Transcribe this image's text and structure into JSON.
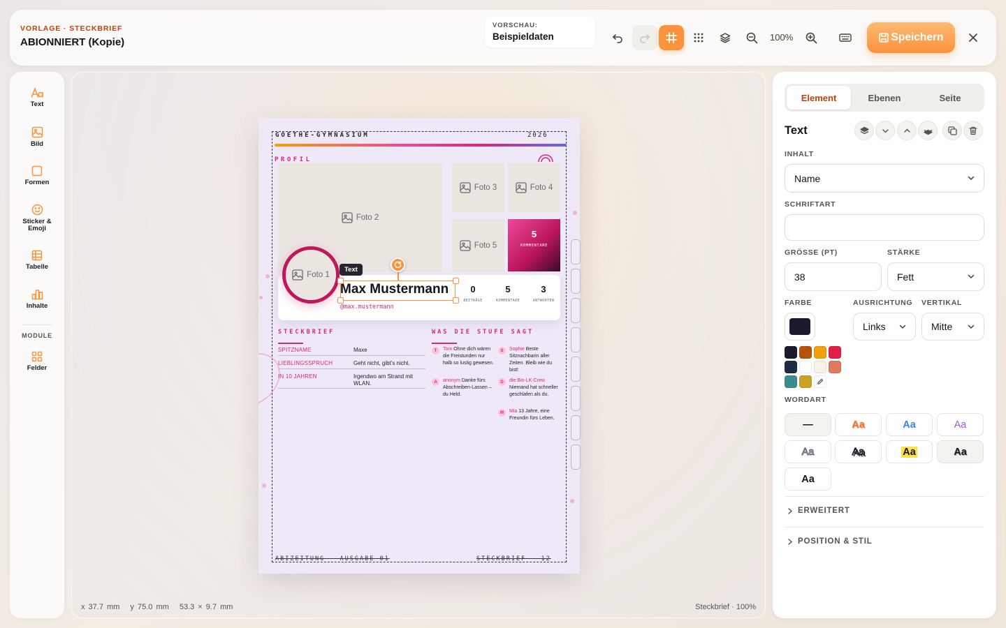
{
  "header": {
    "kicker": "VORLAGE · STECKBRIEF",
    "title": "ABIONNIERT (Kopie)",
    "preview_label": "VORSCHAU:",
    "preview_value": "Beispieldaten",
    "zoom": "100%",
    "save_label": "Speichern",
    "icons": [
      "undo-icon",
      "redo-icon",
      "grid-crop-icon",
      "dot-grid-icon",
      "layers-icon",
      "zoom-out-icon",
      "zoom-in-icon",
      "keyboard-icon",
      "save-icon",
      "close-icon"
    ]
  },
  "tools": {
    "items": [
      {
        "label": "Text",
        "icon": "text-icon"
      },
      {
        "label": "Bild",
        "icon": "image-icon"
      },
      {
        "label": "Formen",
        "icon": "square-icon"
      },
      {
        "label": "Sticker &",
        "label2": "Emoji",
        "icon": "smiley-icon"
      },
      {
        "label": "Tabelle",
        "icon": "table-icon"
      },
      {
        "label": "Inhalte",
        "icon": "bar-chart-icon"
      }
    ],
    "section": "MODULE",
    "module": {
      "label": "Felder",
      "icon": "fields-icon"
    }
  },
  "canvas": {
    "status": {
      "x": "x 37.7 mm",
      "y": "y 75.0 mm",
      "size": "53.3 × 9.7 mm",
      "right": "Steckbrief · 100%"
    },
    "page": {
      "school": "GOETHE-GYMNASIUM",
      "year": "2026",
      "profil": "PROFIL",
      "photos": [
        "Foto 1",
        "Foto 2",
        "Foto 3",
        "Foto 4",
        "Foto 5"
      ],
      "stat_card": {
        "value": "5",
        "label": "KOMMENTARE"
      },
      "name": "Max Mustermann",
      "handle": "@max.mustermann",
      "selection_tag": "Text",
      "stats": [
        {
          "value": "0",
          "label": "BEITRÄGE"
        },
        {
          "value": "5",
          "label": "KOMMENTARE"
        },
        {
          "value": "3",
          "label": "ANTWORTEN"
        }
      ],
      "steckbrief_title": "STECKBRIEF",
      "facts": [
        {
          "key": "SPITZNAME",
          "value": "Maxe"
        },
        {
          "key": "LIEBLINGSSPRUCH",
          "value": "Geht nicht, gibt's nicht."
        },
        {
          "key": "IN 10 JAHREN",
          "value": "Irgendwo am Strand mit WLAN."
        }
      ],
      "quotes_title": "WAS DIE STUFE SAGT",
      "quotes": [
        {
          "initial": "T",
          "who": "Tom",
          "text": " Ohne dich wären die Freistunden nur halb so lustig gewesen."
        },
        {
          "initial": "A",
          "who": "anonym",
          "text": " Danke fürs Abschreiben-Lassen – du Held."
        },
        {
          "initial": "S",
          "who": "Sophie",
          "text": " Beste Sitznachbarin aller Zeiten. Bleib wie du bist!"
        },
        {
          "initial": "D",
          "who": "die Bio-LK-Crew",
          "text": " Niemand hat schneller geschlafen als du."
        },
        {
          "initial": "M",
          "who": "Mia",
          "text": " 13 Jahre, eine Freundin fürs Leben."
        }
      ],
      "footer_left": "ABIZEITUNG — AUSGABE 01",
      "footer_right": "STECKBRIEF — 12"
    }
  },
  "panel": {
    "tabs": [
      "Element",
      "Ebenen",
      "Seite"
    ],
    "active_tab": "Element",
    "title": "Text",
    "inhalt_label": "INHALT",
    "inhalt_value": "Name",
    "schriftart_label": "SCHRIFTART",
    "schriftart_value": "",
    "groesse_label": "GRÖSSE (PT)",
    "groesse_value": "38",
    "staerke_label": "STÄRKE",
    "staerke_value": "Fett",
    "farbe_label": "FARBE",
    "farbe_value": "#1c1b2e",
    "ausrichtung_label": "AUSRICHTUNG",
    "ausrichtung_value": "Links",
    "vertikal_label": "VERTIKAL",
    "vertikal_value": "Mitte",
    "swatches": [
      "#1c1b2e",
      "#b45309",
      "#f59e0b",
      "#e11d48",
      "#1e2a44",
      "#ffffff",
      "#f7f1e6",
      "#e07a5f",
      "#3d8b8b",
      "#c9a227"
    ],
    "wordart_label": "WORDART",
    "wordart": [
      "—",
      "Aa",
      "Aa",
      "Aa",
      "Aa",
      "Aa",
      "Aa",
      "Aa",
      "Aa"
    ],
    "accordions": [
      "ERWEITERT",
      "POSITION & STIL"
    ]
  }
}
